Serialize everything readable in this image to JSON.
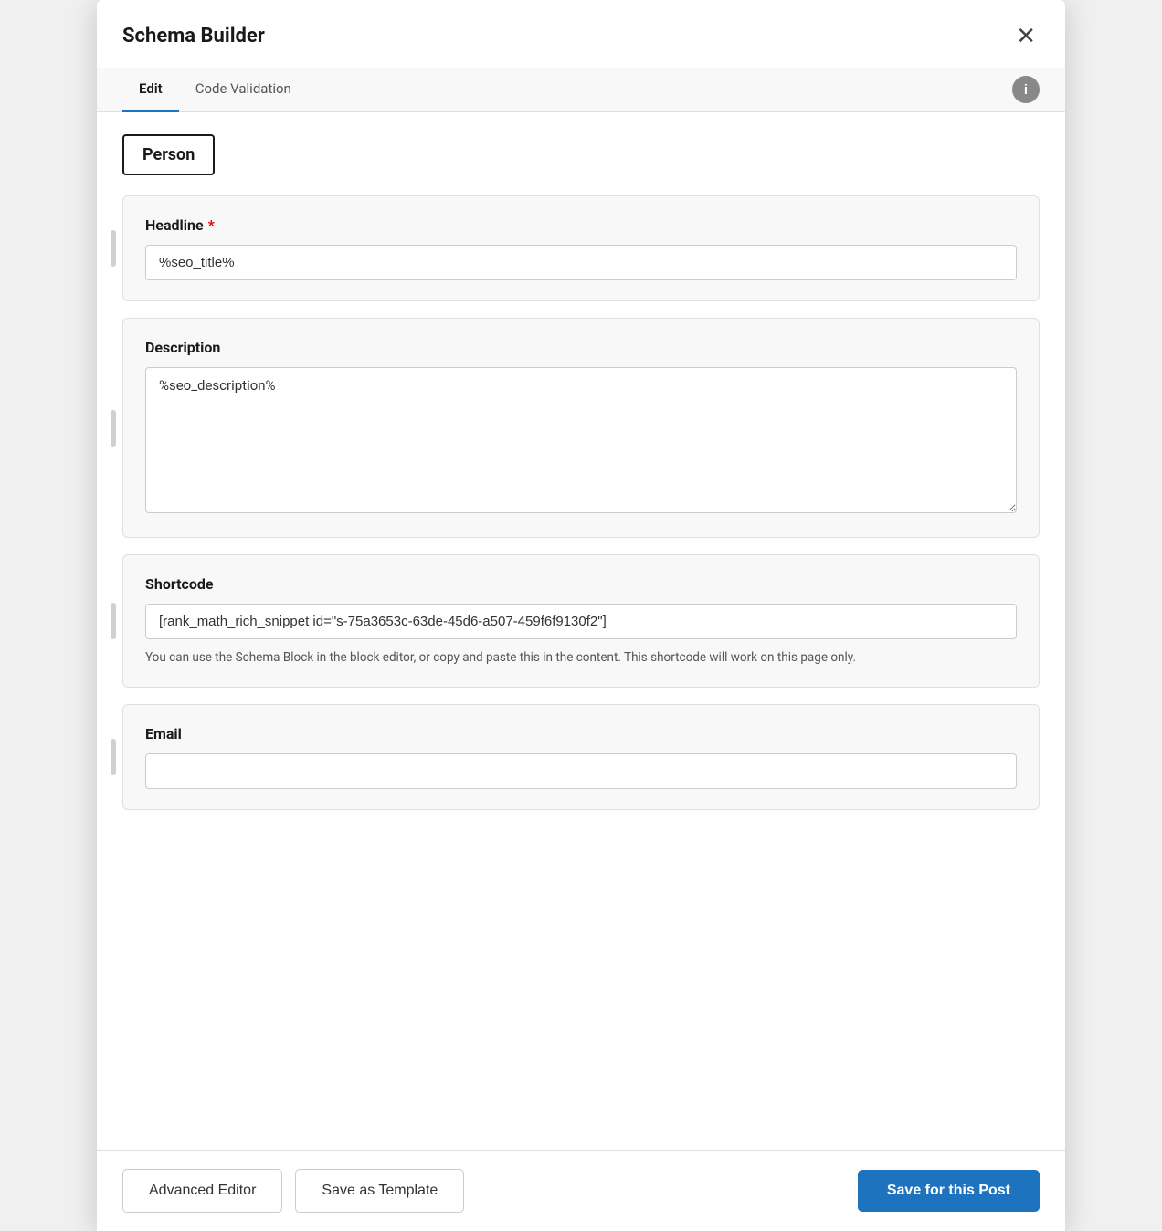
{
  "modal": {
    "title": "Schema Builder",
    "close_label": "✕"
  },
  "tabs": {
    "items": [
      {
        "label": "Edit",
        "active": true
      },
      {
        "label": "Code Validation",
        "active": false
      }
    ],
    "info_label": "i"
  },
  "schema_type": "Person",
  "fields": [
    {
      "id": "headline",
      "label": "Headline",
      "required": true,
      "type": "input",
      "value": "%seo_title%",
      "placeholder": ""
    },
    {
      "id": "description",
      "label": "Description",
      "required": false,
      "type": "textarea",
      "value": "%seo_description%",
      "placeholder": ""
    },
    {
      "id": "shortcode",
      "label": "Shortcode",
      "required": false,
      "type": "input",
      "value": "[rank_math_rich_snippet id=\"s-75a3653c-63de-45d6-a507-459f6f9130f2\"]",
      "placeholder": "",
      "hint": "You can use the Schema Block in the block editor, or copy and paste this in the content. This shortcode will work on this page only."
    },
    {
      "id": "email",
      "label": "Email",
      "required": false,
      "type": "input",
      "value": "",
      "placeholder": ""
    }
  ],
  "footer": {
    "advanced_editor_label": "Advanced Editor",
    "save_as_template_label": "Save as Template",
    "save_for_post_label": "Save for this Post"
  }
}
